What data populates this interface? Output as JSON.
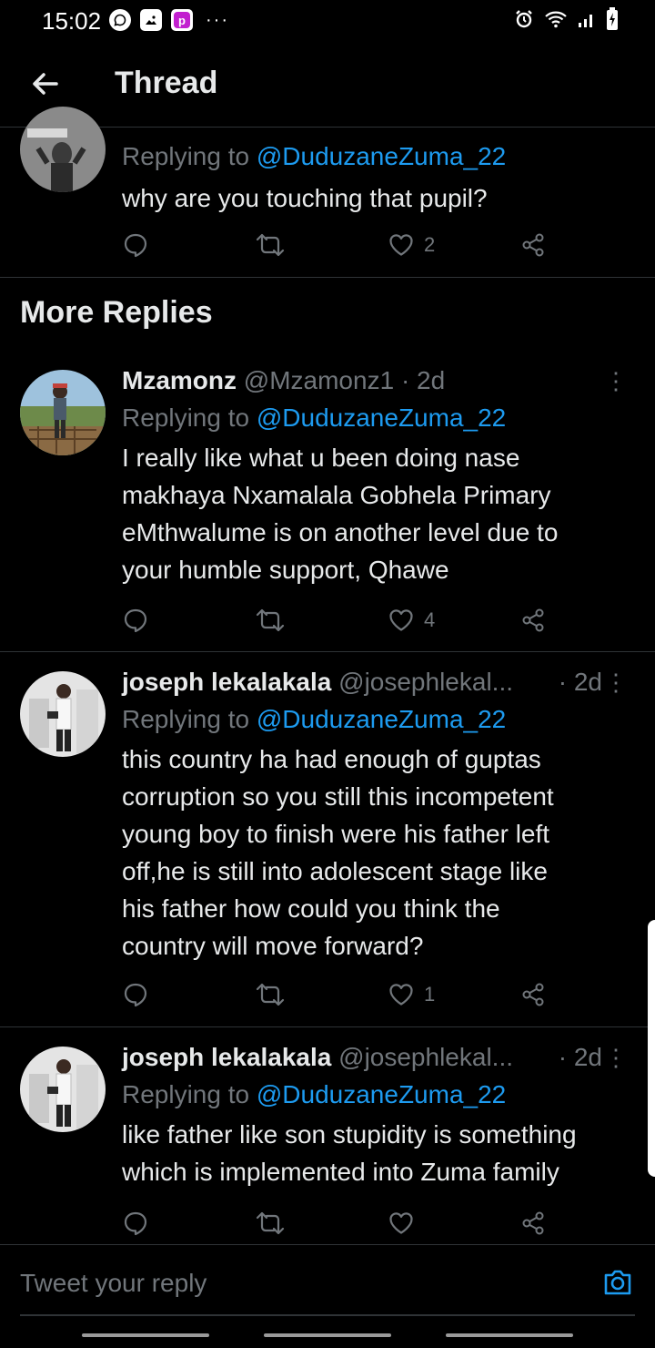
{
  "status_bar": {
    "time": "15:02",
    "left_icons": [
      "whatsapp-icon",
      "gallery-icon",
      "p-app-icon",
      "more-dots"
    ],
    "right_icons": [
      "alarm-icon",
      "wifi-icon",
      "signal-icon",
      "battery-icon"
    ]
  },
  "header": {
    "title": "Thread",
    "back_icon": "arrow-left-icon"
  },
  "partial_tweet": {
    "replying_prefix": "Replying to",
    "mention": "@DuduzaneZuma_22",
    "text": "why are you touching that pupil?",
    "likes": "2"
  },
  "section": {
    "title": "More Replies"
  },
  "tweets": [
    {
      "name": "Mzamonz",
      "handle": "@Mzamonz1",
      "separator": "·",
      "time": "2d",
      "replying_prefix": "Replying to",
      "mention": "@DuduzaneZuma_22",
      "lines": [
        "I really like what u been doing nase",
        "makhaya Nxamalala Gobhela Primary",
        "eMthwalume is on another level due to",
        "your humble support, Qhawe"
      ],
      "likes": "4"
    },
    {
      "name": "joseph lekalakala",
      "handle": "@josephlekal...",
      "separator": "·",
      "time": "2d",
      "replying_prefix": "Replying to",
      "mention": "@DuduzaneZuma_22",
      "lines": [
        "this country ha had enough of guptas",
        "corruption so you still this incompetent",
        "young boy to finish were his father left",
        "off,he is still into adolescent stage like",
        "his father how could you think the",
        "country will move forward?"
      ],
      "likes": "1"
    },
    {
      "name": "joseph lekalakala",
      "handle": "@josephlekal...",
      "separator": "·",
      "time": "2d",
      "replying_prefix": "Replying to",
      "mention": "@DuduzaneZuma_22",
      "lines": [
        "like father like son stupidity is something",
        "which is implemented into Zuma family"
      ],
      "likes": ""
    }
  ],
  "more_icon": "⋮",
  "reply_bar": {
    "placeholder": "Tweet your reply",
    "camera_icon": "camera-icon"
  },
  "colors": {
    "background": "#000000",
    "text": "#e7e9ea",
    "secondary": "#71767b",
    "accent": "#1d9bf0",
    "divider": "#2f3336"
  }
}
